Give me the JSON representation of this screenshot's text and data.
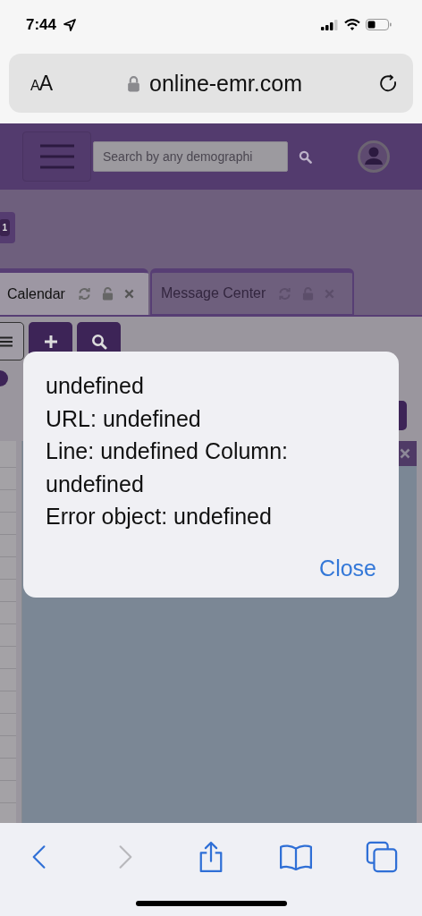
{
  "status_bar": {
    "time": "7:44"
  },
  "address_bar": {
    "text_size_button": "AA",
    "url": "online-emr.com"
  },
  "header": {
    "search": {
      "placeholder": "Search by any demographi"
    }
  },
  "badge": "1",
  "tabs": [
    {
      "label": "Calendar",
      "selected": true
    },
    {
      "label": "Message Center",
      "selected": false
    }
  ],
  "alert": {
    "lines": [
      "undefined",
      "URL: undefined",
      "Line: undefined Column: undefined",
      "Error object: undefined"
    ],
    "button": "Close"
  },
  "toolbar": {
    "buttons": [
      {
        "kind": "back",
        "disabled": false
      },
      {
        "kind": "forward",
        "disabled": true
      },
      {
        "kind": "share",
        "disabled": false
      },
      {
        "kind": "bookmarks",
        "disabled": false
      },
      {
        "kind": "tabs",
        "disabled": false
      }
    ]
  }
}
